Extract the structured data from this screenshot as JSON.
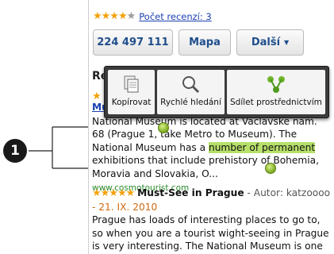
{
  "callout": {
    "number": "1"
  },
  "rating": {
    "stars_filled": 4,
    "stars_total": 5,
    "review_count_link": "Počet recenzí: 3"
  },
  "buttons": {
    "phone": "224 497 111",
    "map": "Mapa",
    "more": "Další"
  },
  "section_head_partial": "Re",
  "popup": {
    "copy": "Kopírovat",
    "quick_search": "Rychlé hledání",
    "share": "Sdílet prostřednictvím"
  },
  "review1": {
    "title_partial": "Mu",
    "text_before": "National Museum is located at Václavské nám. 68 (Prague 1, take Metro to Museum). The National Museum has a ",
    "highlighted": "number of permanent",
    "text_after": " exhibitions that include prehistory of Bohemia, Moravia and Slovakia, O...",
    "source": "www.cosmotourist.com"
  },
  "review2": {
    "title": "Must-See in Prague",
    "author_sep": " - Autor: ",
    "author": "katzoooo",
    "date": "- 21. IX. 2010",
    "text": "Prague has loads of interesting places to go to, so when you are a tourist wight-seeing in Prague is very interesting. The National Museum is one of"
  },
  "colors": {
    "star": "#f2a20a",
    "link": "#1a3fb0",
    "highlight": "#b7e06a",
    "popup_bg": "#3b3b3b"
  }
}
